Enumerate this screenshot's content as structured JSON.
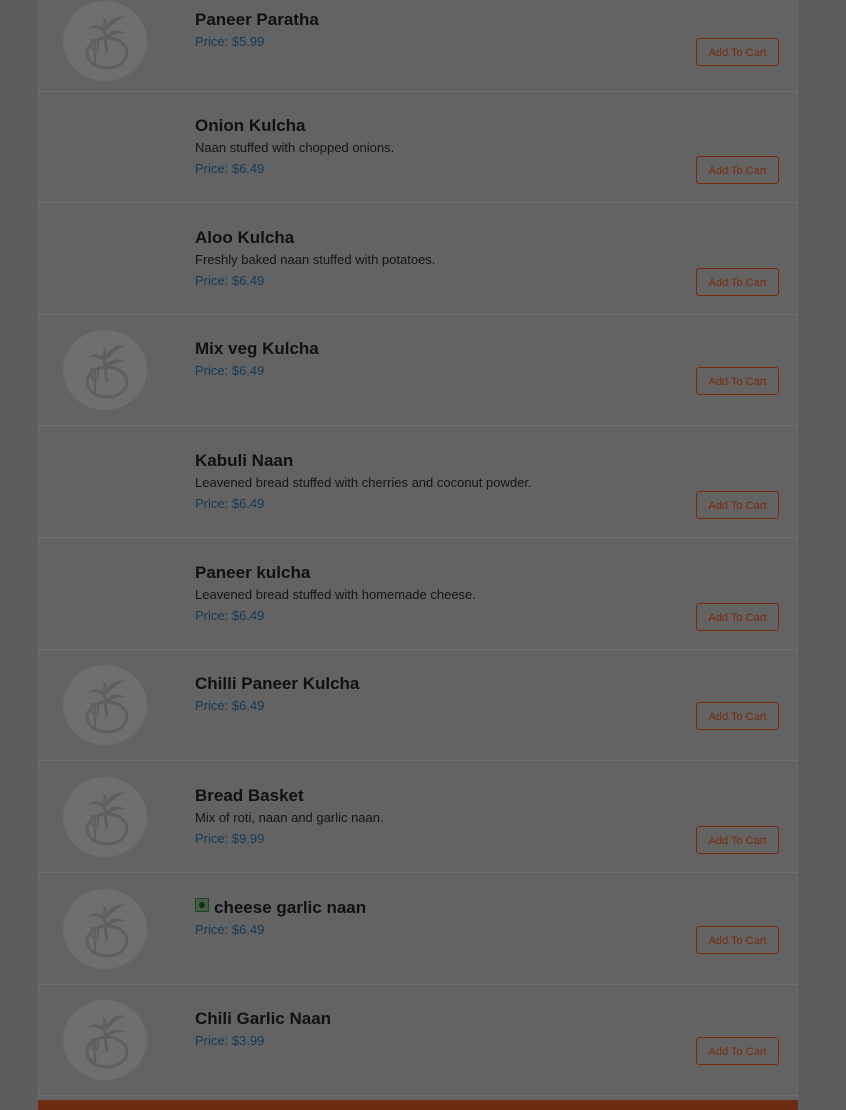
{
  "menu": {
    "cart_label": "Add To Cart",
    "items": [
      {
        "name": "Paneer Paratha",
        "description": "",
        "price": "Price: $5.99",
        "has_image": true,
        "veg_icon": false
      },
      {
        "name": "Onion Kulcha",
        "description": "Naan stuffed with chopped onions.",
        "price": "Price: $6.49",
        "has_image": false,
        "veg_icon": false
      },
      {
        "name": "Aloo Kulcha",
        "description": "Freshly baked naan stuffed with potatoes.",
        "price": "Price: $6.49",
        "has_image": false,
        "veg_icon": false
      },
      {
        "name": "Mix veg Kulcha",
        "description": "",
        "price": "Price: $6.49",
        "has_image": true,
        "veg_icon": false
      },
      {
        "name": "Kabuli Naan",
        "description": "Leavened bread stuffed with cherries and coconut powder.",
        "price": "Price: $6.49",
        "has_image": false,
        "veg_icon": false
      },
      {
        "name": "Paneer kulcha",
        "description": "Leavened bread stuffed with homemade cheese.",
        "price": "Price: $6.49",
        "has_image": false,
        "veg_icon": false
      },
      {
        "name": "Chilli Paneer Kulcha",
        "description": "",
        "price": "Price: $6.49",
        "has_image": true,
        "veg_icon": false
      },
      {
        "name": "Bread Basket",
        "description": "Mix of roti, naan and garlic naan.",
        "price": "Price: $9.99",
        "has_image": true,
        "veg_icon": false
      },
      {
        "name": "cheese garlic naan",
        "description": "",
        "price": "Price: $6.49",
        "has_image": true,
        "veg_icon": true
      },
      {
        "name": "Chili Garlic Naan",
        "description": "",
        "price": "Price: $3.99",
        "has_image": true,
        "veg_icon": false
      }
    ]
  },
  "colors": {
    "price": "#163a55",
    "cart_button": "#7a2b0a",
    "footer_bar": "#6b2c12",
    "veg_indicator": "#0a3a0a"
  },
  "icons": {
    "placeholder": "restaurant-logo-icon",
    "veg": "veg-indicator-icon"
  }
}
